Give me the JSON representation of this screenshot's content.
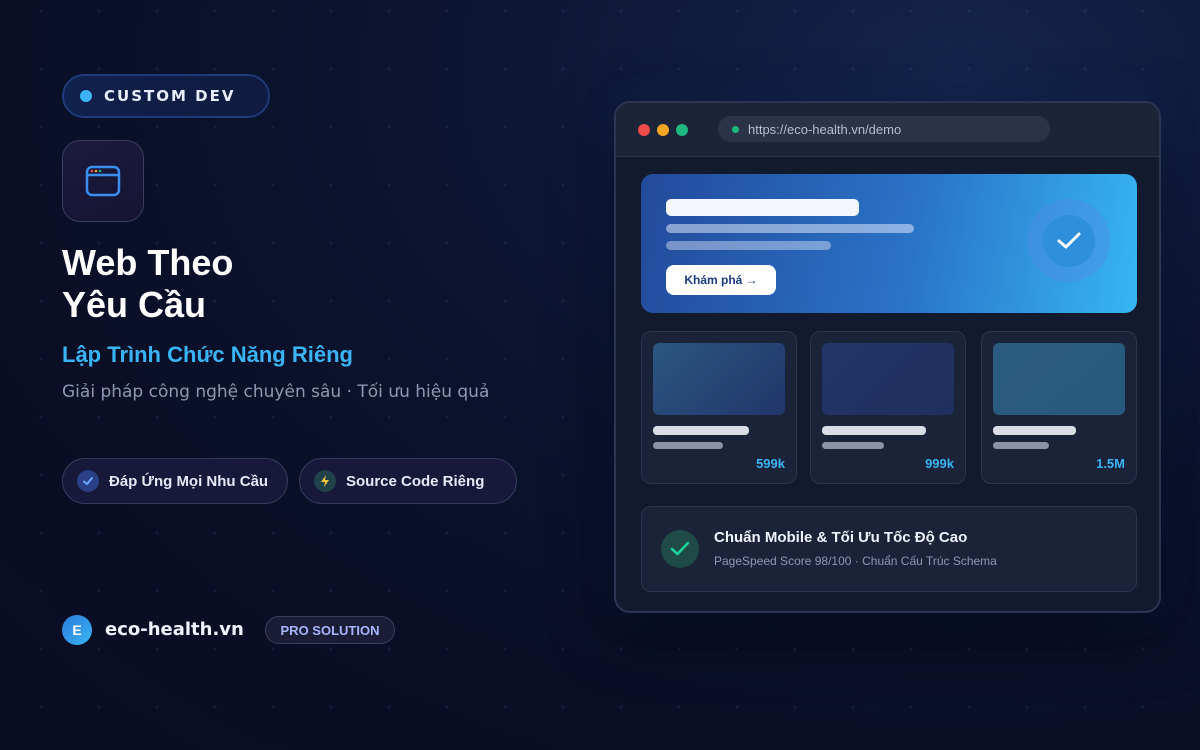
{
  "badge": {
    "label": "CUSTOM DEV"
  },
  "hero": {
    "title_line1": "Web Theo",
    "title_line2": "Yêu Cầu",
    "subtitle": "Lập Trình Chức Năng Riêng",
    "tagline": "Giải pháp công nghệ chuyên sâu · Tối ưu hiệu quả"
  },
  "features": [
    {
      "label": "Đáp Ứng Mọi Nhu Cầu",
      "icon": "check-icon"
    },
    {
      "label": "Source Code Riêng",
      "icon": "lightning-icon"
    }
  ],
  "footer": {
    "logo_letter": "E",
    "domain": "eco-health.vn",
    "pill": "PRO SOLUTION"
  },
  "browser": {
    "url": "https://eco-health.vn/demo",
    "hero_button": "Khám phá →",
    "cards": [
      {
        "price": "599k"
      },
      {
        "price": "999k"
      },
      {
        "price": "1.5M"
      }
    ],
    "status": {
      "title": "Chuẩn Mobile & Tối Ưu Tốc Độ Cao",
      "subtitle": "PageSpeed Score 98/100 · Chuẩn Cấu Trúc Schema"
    }
  },
  "colors": {
    "accent": "#3ab4f5",
    "background": "#0c1430",
    "success": "#1fb880"
  }
}
